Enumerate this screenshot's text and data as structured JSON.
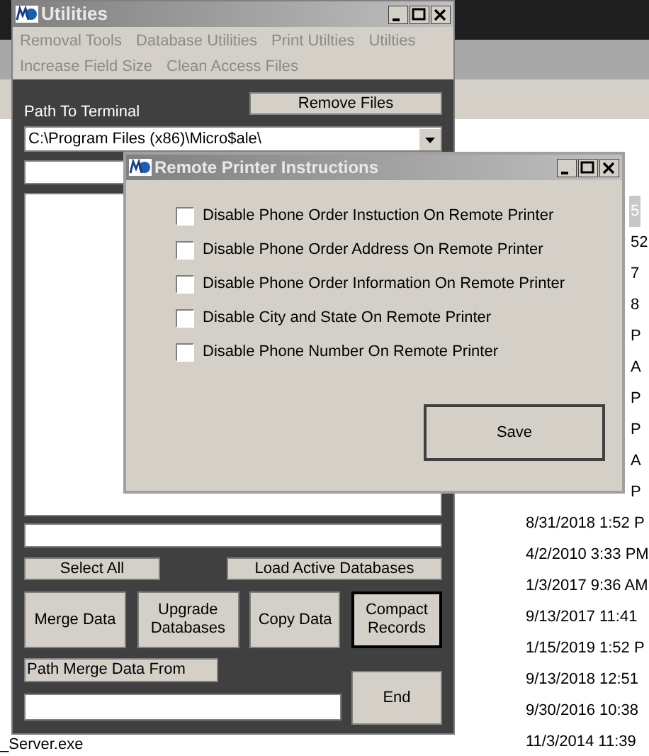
{
  "background": {
    "dates": [
      {
        "text": "5",
        "selected": true
      },
      {
        "text": "52",
        "selected": false
      },
      {
        "text": "7",
        "selected": false
      },
      {
        "text": "8",
        "selected": false
      },
      {
        "text": "P",
        "selected": false
      },
      {
        "text": "A",
        "selected": false
      },
      {
        "text": "P",
        "selected": false
      },
      {
        "text": "P",
        "selected": false
      },
      {
        "text": "A",
        "selected": false
      },
      {
        "text": "P",
        "selected": false
      },
      {
        "text": "8/31/2018 1:52 P",
        "selected": false
      },
      {
        "text": "4/2/2010 3:33 PM",
        "selected": false
      },
      {
        "text": "1/3/2017 9:36 AM",
        "selected": false
      },
      {
        "text": "9/13/2017 11:41",
        "selected": false
      },
      {
        "text": "1/15/2019 1:52 P",
        "selected": false
      },
      {
        "text": "9/13/2018 12:51",
        "selected": false
      },
      {
        "text": "9/30/2016 10:38",
        "selected": false
      },
      {
        "text": "11/3/2014 11:39",
        "selected": false
      }
    ],
    "file_name": "_Server.exe"
  },
  "utilities": {
    "title": "Utilities",
    "menu": [
      [
        "Removal Tools",
        "Database Utilities",
        "Print Utilties",
        "Utilties"
      ],
      [
        "Increase Field Size",
        "Clean Access Files"
      ]
    ],
    "path_label": "Path To Terminal",
    "remove_button": "Remove Files",
    "terminal_path": "C:\\Program Files (x86)\\Micro$ale\\",
    "select_all": "Select All",
    "load_button": "Load Active Databases",
    "actions": [
      {
        "label": "Merge Data",
        "default": false
      },
      {
        "label": "Upgrade Databases",
        "default": false
      },
      {
        "label": "Copy Data",
        "default": false
      },
      {
        "label": "Compact Records",
        "default": true
      }
    ],
    "merge_path_label": "Path Merge Data From",
    "end_button": "End"
  },
  "dialog": {
    "title": "Remote Printer Instructions",
    "options": [
      {
        "label": "Disable Phone Order Instuction On Remote Printer",
        "checked": false
      },
      {
        "label": "Disable Phone Order Address On Remote Printer",
        "checked": false
      },
      {
        "label": "Disable Phone Order Information On Remote Printer",
        "checked": false
      },
      {
        "label": "Disable City and State On Remote Printer",
        "checked": false
      },
      {
        "label": "Disable Phone Number On Remote Printer",
        "checked": false
      }
    ],
    "save_button": "Save"
  }
}
